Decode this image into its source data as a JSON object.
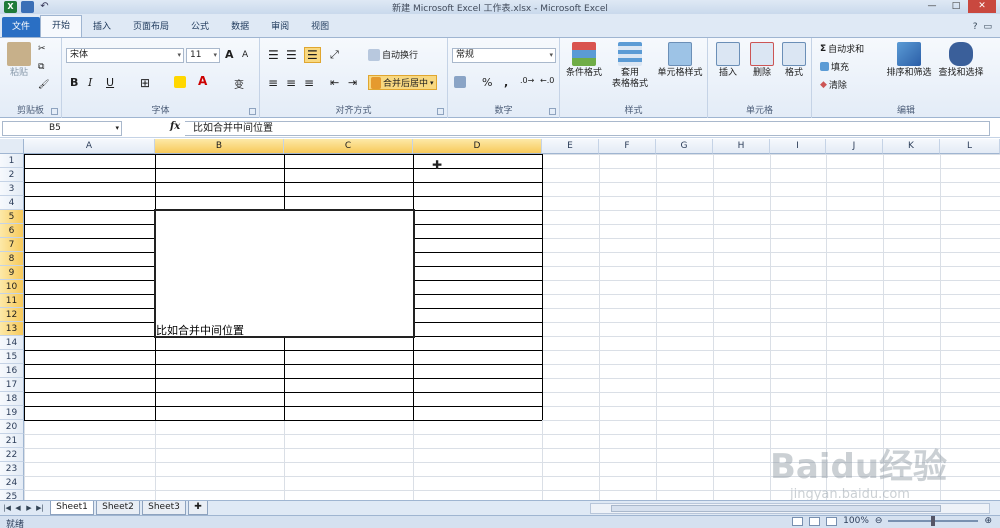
{
  "window": {
    "title": "新建 Microsoft Excel 工作表.xlsx - Microsoft Excel",
    "controls": [
      "—",
      "□",
      "✕"
    ]
  },
  "tabs": [
    {
      "label": "文件",
      "state": "file"
    },
    {
      "label": "开始",
      "state": "active"
    },
    {
      "label": "插入",
      "state": ""
    },
    {
      "label": "页面布局",
      "state": ""
    },
    {
      "label": "公式",
      "state": ""
    },
    {
      "label": "数据",
      "state": ""
    },
    {
      "label": "审阅",
      "state": ""
    },
    {
      "label": "视图",
      "state": ""
    }
  ],
  "ribbon": {
    "clipboard": {
      "paste": "粘贴",
      "label": "剪贴板"
    },
    "font": {
      "name": "宋体",
      "size": "11",
      "bold": "B",
      "italic": "I",
      "underline": "U",
      "grow": "A",
      "shrink": "A",
      "label": "字体"
    },
    "alignment": {
      "wrap": "自动换行",
      "merge": "合并后居中",
      "label": "对齐方式"
    },
    "number": {
      "format": "常规",
      "percent": "%",
      "comma": ",",
      "label": "数字"
    },
    "styles": {
      "conditional": "条件格式",
      "table_1": "套用",
      "table_2": "表格格式",
      "cell_styles": "单元格样式",
      "label": "样式"
    },
    "cells": {
      "insert": "插入",
      "delete": "删除",
      "format": "格式",
      "label": "单元格"
    },
    "editing": {
      "autosum": "自动求和",
      "fill": "填充",
      "clear": "清除",
      "sort": "排序和筛选",
      "find": "查找和选择",
      "label": "编辑"
    }
  },
  "formula_bar": {
    "name_box": "B5",
    "fx": "fx",
    "content": "比如合并中间位置"
  },
  "columns": [
    "A",
    "B",
    "C",
    "D",
    "E",
    "F",
    "G",
    "H",
    "I",
    "J",
    "K",
    "L"
  ],
  "selected_columns": [
    "B",
    "C",
    "D"
  ],
  "rows": [
    "1",
    "2",
    "3",
    "4",
    "5",
    "6",
    "7",
    "8",
    "9",
    "10",
    "11",
    "12",
    "13",
    "14",
    "15",
    "16",
    "17",
    "18",
    "19",
    "20",
    "21",
    "22",
    "23",
    "24",
    "25"
  ],
  "selected_rows": [
    "5",
    "6",
    "7",
    "8",
    "9",
    "10",
    "11",
    "12",
    "13"
  ],
  "merged_cell": {
    "range": "B5:C13",
    "text": "比如合并中间位置"
  },
  "sheets": [
    {
      "label": "Sheet1",
      "active": true
    },
    {
      "label": "Sheet2",
      "active": false
    },
    {
      "label": "Sheet3",
      "active": false
    }
  ],
  "status": {
    "ready": "就绪",
    "zoom": "100%"
  },
  "watermark": {
    "brand": "Baidu经验",
    "url": "jingyan.baidu.com"
  }
}
